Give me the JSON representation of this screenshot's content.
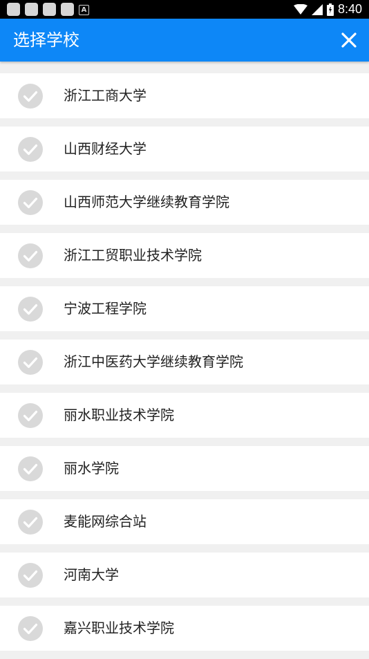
{
  "status_bar": {
    "time": "8:40",
    "icons": [
      "notification-square-icon",
      "notification-square-icon",
      "notification-square-icon",
      "notification-square-icon",
      "a-notification-icon",
      "wifi-icon",
      "cell-signal-icon",
      "battery-icon"
    ]
  },
  "app_bar": {
    "title": "选择学校",
    "close_icon": "close-icon",
    "background_color": "#0d87f7"
  },
  "schools": [
    {
      "name": "浙江工商大学"
    },
    {
      "name": "山西财经大学"
    },
    {
      "name": "山西师范大学继续教育学院"
    },
    {
      "name": "浙江工贸职业技术学院"
    },
    {
      "name": "宁波工程学院"
    },
    {
      "name": "浙江中医药大学继续教育学院"
    },
    {
      "name": "丽水职业技术学院"
    },
    {
      "name": "丽水学院"
    },
    {
      "name": "麦能网综合站"
    },
    {
      "name": "河南大学"
    },
    {
      "name": "嘉兴职业技术学院"
    }
  ],
  "check_icon_color": "#d9d9d9"
}
